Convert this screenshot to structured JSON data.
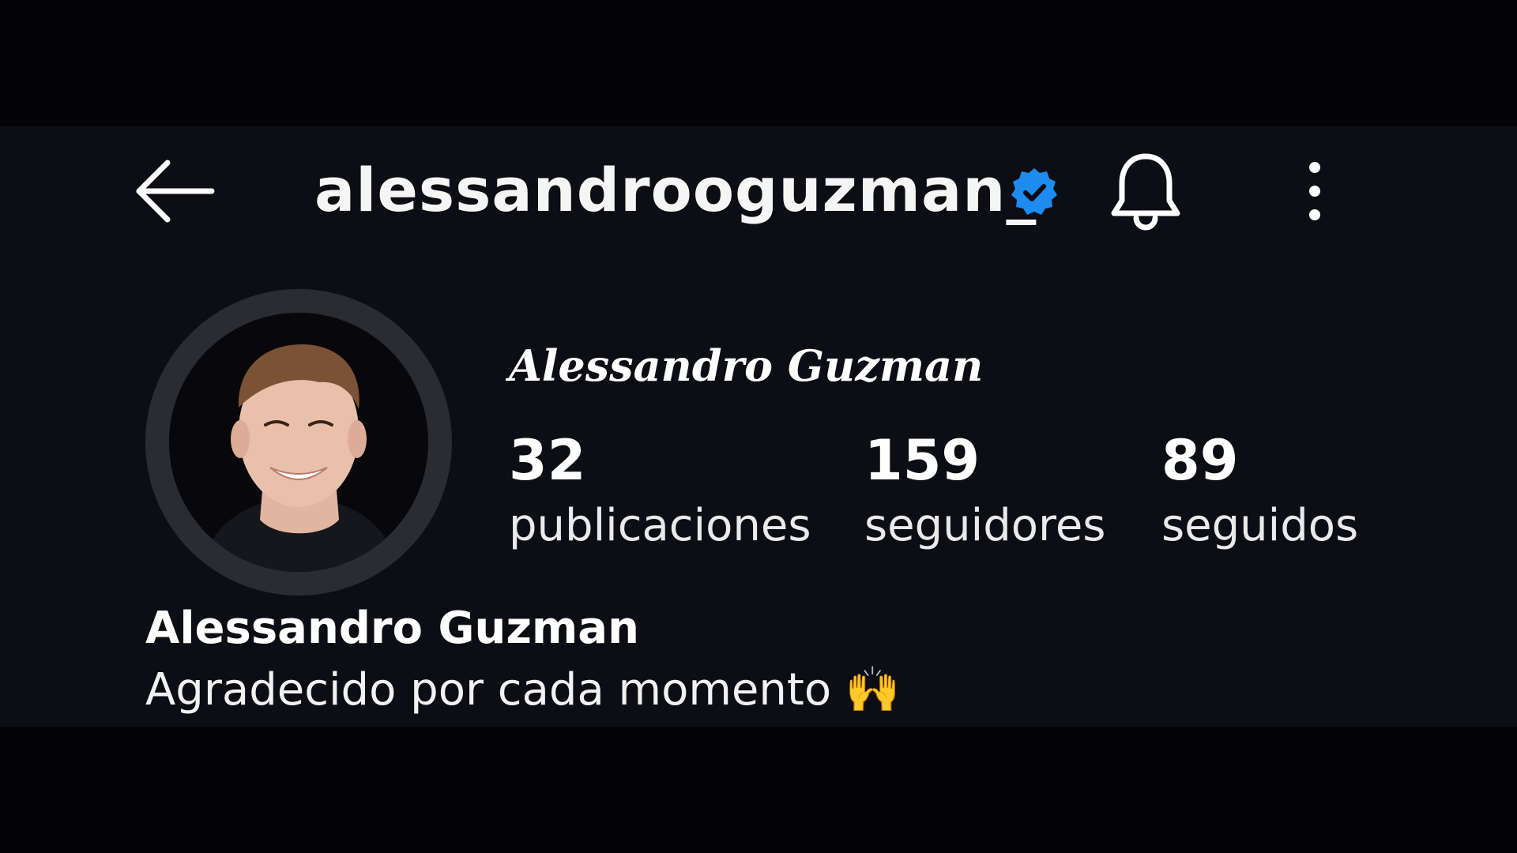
{
  "header": {
    "back_icon": "arrow-left-icon",
    "username": "alessandrooguzman_",
    "verified_icon": "verified-badge-icon",
    "bell_icon": "bell-icon",
    "more_icon": "more-vertical-icon"
  },
  "profile": {
    "display_name": "Alessandro Guzman",
    "stats": {
      "posts": {
        "value": "32",
        "label": "publicaciones"
      },
      "followers": {
        "value": "159",
        "label": "seguidores"
      },
      "following": {
        "value": "89",
        "label": "seguidos"
      }
    }
  },
  "bio": {
    "name": "Alessandro Guzman",
    "text": "Agradecido por cada momento 🙌"
  },
  "colors": {
    "background": "#0c0e14",
    "verified": "#1d8bf0",
    "avatar_ring": "#2a2c31"
  }
}
